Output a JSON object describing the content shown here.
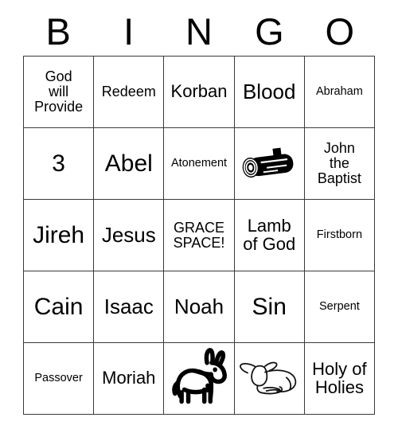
{
  "card": {
    "header_letters": [
      "B",
      "I",
      "N",
      "G",
      "O"
    ],
    "rows": [
      [
        {
          "text": "God\nwill\nProvide",
          "size": "sm",
          "type": "text"
        },
        {
          "text": "Redeem",
          "size": "sm",
          "type": "text"
        },
        {
          "text": "Korban",
          "size": "md",
          "type": "text"
        },
        {
          "text": "Blood",
          "size": "lg",
          "type": "text"
        },
        {
          "text": "Abraham",
          "size": "xs",
          "type": "text"
        }
      ],
      [
        {
          "text": "3",
          "size": "xl",
          "type": "text"
        },
        {
          "text": "Abel",
          "size": "xl",
          "type": "text"
        },
        {
          "text": "Atonement",
          "size": "xs",
          "type": "text"
        },
        {
          "text": "",
          "size": "md",
          "type": "image",
          "image": "log-icon"
        },
        {
          "text": "John\nthe\nBaptist",
          "size": "sm",
          "type": "text"
        }
      ],
      [
        {
          "text": "Jireh",
          "size": "xl",
          "type": "text"
        },
        {
          "text": "Jesus",
          "size": "lg",
          "type": "text"
        },
        {
          "text": "GRACE\nSPACE!",
          "size": "sm",
          "type": "text"
        },
        {
          "text": "Lamb\nof God",
          "size": "md",
          "type": "text"
        },
        {
          "text": "Firstborn",
          "size": "xs",
          "type": "text"
        }
      ],
      [
        {
          "text": "Cain",
          "size": "xl",
          "type": "text"
        },
        {
          "text": "Isaac",
          "size": "lg",
          "type": "text"
        },
        {
          "text": "Noah",
          "size": "lg",
          "type": "text"
        },
        {
          "text": "Sin",
          "size": "xl",
          "type": "text"
        },
        {
          "text": "Serpent",
          "size": "xs",
          "type": "text"
        }
      ],
      [
        {
          "text": "Passover",
          "size": "xs",
          "type": "text"
        },
        {
          "text": "Moriah",
          "size": "md",
          "type": "text"
        },
        {
          "text": "",
          "size": "md",
          "type": "image",
          "image": "donkey-icon"
        },
        {
          "text": "",
          "size": "md",
          "type": "image",
          "image": "lamb-icon"
        },
        {
          "text": "Holy of\nHolies",
          "size": "md",
          "type": "text"
        }
      ]
    ]
  },
  "colors": {
    "background": "#ffffff",
    "text": "#000000",
    "grid_line": "#3a3a3a"
  }
}
